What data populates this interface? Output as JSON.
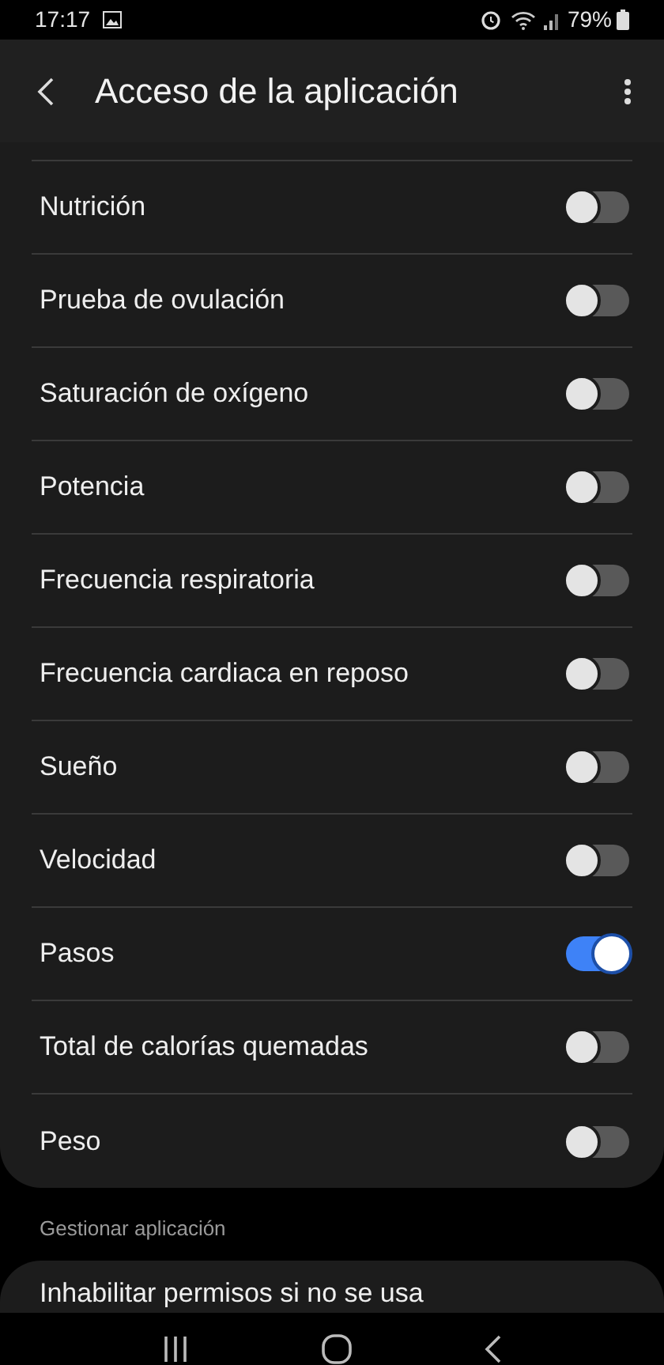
{
  "status_bar": {
    "time": "17:17",
    "battery": "79%"
  },
  "header": {
    "title": "Acceso de la aplicación"
  },
  "permissions": [
    {
      "label": "Nutrición",
      "on": false
    },
    {
      "label": "Prueba de ovulación",
      "on": false
    },
    {
      "label": "Saturación de oxígeno",
      "on": false
    },
    {
      "label": "Potencia",
      "on": false
    },
    {
      "label": "Frecuencia respiratoria",
      "on": false
    },
    {
      "label": "Frecuencia cardiaca en reposo",
      "on": false
    },
    {
      "label": "Sueño",
      "on": false
    },
    {
      "label": "Velocidad",
      "on": false
    },
    {
      "label": "Pasos",
      "on": true
    },
    {
      "label": "Total de calorías quemadas",
      "on": false
    },
    {
      "label": "Peso",
      "on": false
    }
  ],
  "manage_section": {
    "title": "Gestionar aplicación",
    "items": [
      "Inhabilitar permisos si no se usa"
    ]
  }
}
